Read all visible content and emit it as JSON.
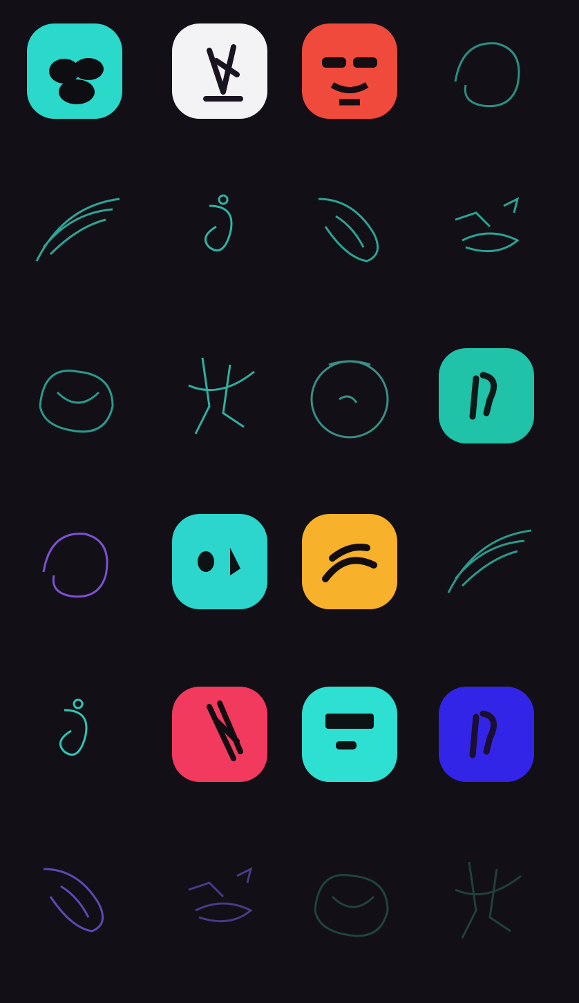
{
  "items": [
    {
      "label": "",
      "icon": "teal-mask-icon",
      "style": "tile",
      "color": "#2bd9cb",
      "ink": "#0d0d12"
    },
    {
      "label": "",
      "icon": "white-anchor-icon",
      "style": "tile",
      "color": "#f3f3f5",
      "ink": "#1a1320"
    },
    {
      "label": "",
      "icon": "red-glasses-face-icon",
      "style": "tile",
      "color": "#ef4a3c",
      "ink": "#140e12"
    },
    {
      "label": "",
      "icon": "line-portrait-icon",
      "style": "line",
      "color": "#2a8f82"
    },
    {
      "label": "",
      "icon": "line-feather-icon",
      "style": "line",
      "color": "#2fa596"
    },
    {
      "label": "",
      "icon": "line-swirl-icon",
      "style": "line",
      "color": "#2fb5a5"
    },
    {
      "label": "",
      "icon": "line-bird-icon",
      "style": "line",
      "color": "#2aa595"
    },
    {
      "label": "",
      "icon": "line-figure-icon",
      "style": "line",
      "color": "#2aa595"
    },
    {
      "label": "",
      "icon": "line-knot-icon",
      "style": "line",
      "color": "#2a9a8b"
    },
    {
      "label": "",
      "icon": "line-abstract-icon",
      "style": "line",
      "color": "#2fb0a0"
    },
    {
      "label": "",
      "icon": "line-circle-icon",
      "style": "line",
      "color": "#3a8f86"
    },
    {
      "label": "",
      "icon": "teal-landscape-icon",
      "style": "tile",
      "color": "#20c2a8",
      "ink": "#0d1a18"
    },
    {
      "label": "",
      "icon": "purple-swirl-icon",
      "style": "line",
      "color": "#7e4fd6"
    },
    {
      "label": "",
      "icon": "teal-wave-icon",
      "style": "tile",
      "color": "#2cd6cc",
      "ink": "#0d1214"
    },
    {
      "label": "",
      "icon": "yellow-brush-icon",
      "style": "tile",
      "color": "#f7b12a",
      "ink": "#120d10"
    },
    {
      "label": "",
      "icon": "line-mountain-icon",
      "style": "line",
      "color": "#2a9a8b"
    },
    {
      "label": "",
      "icon": "teal-chevron-icon",
      "style": "line",
      "color": "#2cc8b8"
    },
    {
      "label": "",
      "icon": "pink-face-icon",
      "style": "tile",
      "color": "#f23a5e",
      "ink": "#120d12"
    },
    {
      "label": "",
      "icon": "aqua-letter-icon",
      "style": "tile",
      "color": "#2ee0d2",
      "ink": "#0d1214"
    },
    {
      "label": "",
      "icon": "blue-face-icon",
      "style": "tile",
      "color": "#3325e8",
      "ink": "#1a0f30"
    },
    {
      "label": "",
      "icon": "purple-leaf-icon",
      "style": "line",
      "color": "#5e48b8"
    },
    {
      "label": "",
      "icon": "purple-orb-icon",
      "style": "line",
      "color": "#4a3a8a"
    },
    {
      "label": "",
      "icon": "dark-wave-icon",
      "style": "line",
      "color": "#20433f"
    },
    {
      "label": "",
      "icon": "dark-orb-icon",
      "style": "line",
      "color": "#20403c"
    }
  ]
}
